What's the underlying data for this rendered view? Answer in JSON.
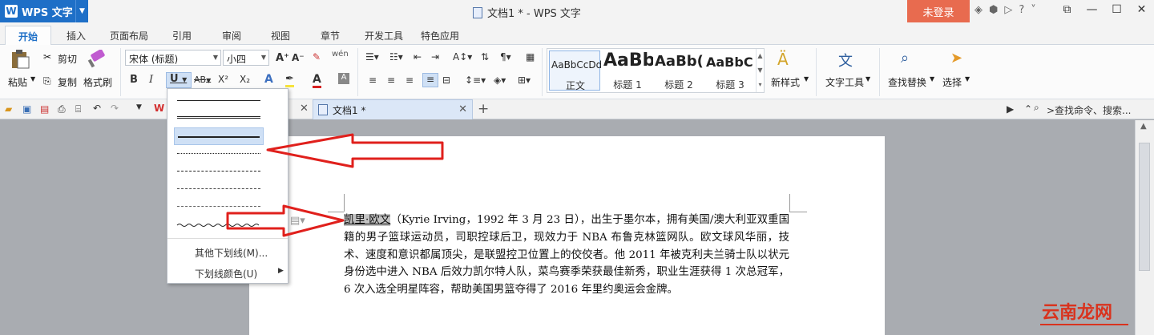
{
  "window": {
    "app_name": "WPS 文字",
    "app_logo": "W",
    "title": "文档1 * - WPS 文字",
    "login_button": "未登录",
    "controls": [
      "—",
      "☐",
      "✕"
    ]
  },
  "tabs": [
    {
      "label": "开始",
      "active": true
    },
    {
      "label": "插入"
    },
    {
      "label": "页面布局"
    },
    {
      "label": "引用"
    },
    {
      "label": "审阅"
    },
    {
      "label": "视图"
    },
    {
      "label": "章节"
    },
    {
      "label": "开发工具"
    },
    {
      "label": "特色应用"
    }
  ],
  "ribbon": {
    "paste": "粘贴",
    "cut": "剪切",
    "copy": "复制",
    "format_painter": "格式刷",
    "font_name": "宋体 (标题)",
    "font_size": "小四",
    "styles": [
      {
        "sample": "AaBbCcDd",
        "label": "正文"
      },
      {
        "sample": "AaBb",
        "label": "标题 1"
      },
      {
        "sample": "AaBb(",
        "label": "标题 2"
      },
      {
        "sample": "AaBbC",
        "label": "标题 3"
      }
    ],
    "new_style": "新样式",
    "text_tools": "文字工具",
    "find_replace": "查找替换",
    "select": "选择"
  },
  "doc_tabs": {
    "active_tab": "文档1 *",
    "search_command": ">查找命令、搜索..."
  },
  "underline_menu": {
    "more": "其他下划线(M)...",
    "color": "下划线颜色(U)"
  },
  "document": {
    "name_highlight": "凯里·欧文",
    "body": "（Kyrie Irving，1992 年 3 月 23 日），出生于墨尔本，拥有美国/澳大利亚双重国籍的男子篮球运动员，司职控球后卫，现效力于 NBA 布鲁克林篮网队。欧文球风华丽，技术、速度和意识都属顶尖，是联盟控卫位置上的佼佼者。他 2011 年被克利夫兰骑士队以状元身份选中进入 NBA 后效力凯尔特人队，菜鸟赛季荣获最佳新秀，职业生涯获得 1 次总冠军，6 次入选全明星阵容，帮助美国男篮夺得了 2016 年里约奥运会金牌。"
  },
  "watermark": "云南龙网",
  "colors": {
    "accent": "#1e6fc7",
    "login": "#e86b4f",
    "arrow": "#e0201c"
  }
}
